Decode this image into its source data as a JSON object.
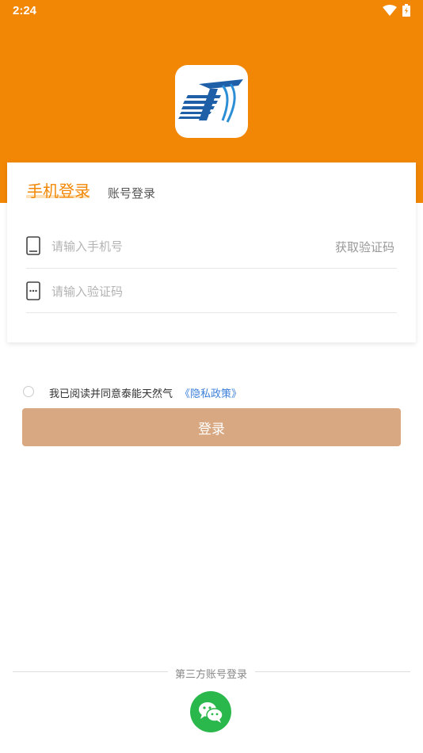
{
  "status_bar": {
    "time": "2:24"
  },
  "colors": {
    "brand_orange": "#f28705",
    "button_disabled": "#d8a882",
    "link_blue": "#3a7fd8",
    "wechat_green": "#2ab84c"
  },
  "tabs": {
    "phone_login": "手机登录",
    "account_login": "账号登录"
  },
  "form": {
    "phone_placeholder": "请输入手机号",
    "get_code_label": "获取验证码",
    "code_placeholder": "请输入验证码"
  },
  "agreement": {
    "text": "我已阅读并同意泰能天然气",
    "policy_link": "《隐私政策》"
  },
  "login_button": "登录",
  "third_party": {
    "label": "第三方账号登录",
    "wechat_icon": "wechat-icon"
  }
}
